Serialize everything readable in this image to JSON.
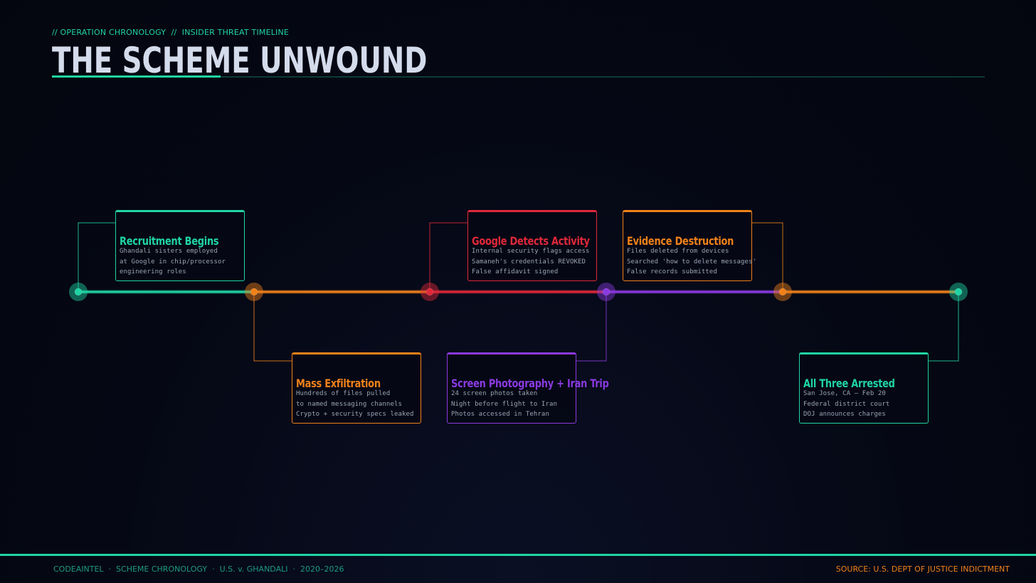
{
  "header": {
    "eyebrow": "// OPERATION CHRONOLOGY  //  INSIDER THREAT TIMELINE",
    "title": "THE SCHEME UNWOUND"
  },
  "colors": {
    "teal": "#20d4a4",
    "orange": "#f0811a",
    "red": "#e0283a",
    "purple": "#8a3ae0",
    "text_muted": "#9aa3b4",
    "background": "#050814"
  },
  "timeline": {
    "nodes": [
      {
        "color": "#20d4a4"
      },
      {
        "color": "#f0811a"
      },
      {
        "color": "#e0283a"
      },
      {
        "color": "#8a3ae0"
      },
      {
        "color": "#f0811a"
      },
      {
        "color": "#20d4a4"
      }
    ],
    "events": [
      {
        "title": "Recruitment Begins",
        "color": "#20d4a4",
        "placement": "above",
        "lines": [
          "Ghandali sisters employed",
          "at Google in chip/processor",
          "engineering roles"
        ]
      },
      {
        "title": "Mass Exfiltration",
        "color": "#f0811a",
        "placement": "below",
        "lines": [
          "Hundreds of files pulled",
          "to named messaging channels",
          "Crypto + security specs leaked"
        ]
      },
      {
        "title": "Google Detects Activity",
        "color": "#e0283a",
        "placement": "above",
        "lines": [
          "Internal security flags access",
          "Samaneh's credentials REVOKED",
          "False affidavit signed"
        ]
      },
      {
        "title": "Screen Photography + Iran Trip",
        "color": "#8a3ae0",
        "placement": "below",
        "lines": [
          "24 screen photos taken",
          "Night before flight to Iran",
          "Photos accessed in Tehran"
        ]
      },
      {
        "title": "Evidence Destruction",
        "color": "#f0811a",
        "placement": "above",
        "lines": [
          "Files deleted from devices",
          "Searched 'how to delete messages'",
          "False records submitted"
        ]
      },
      {
        "title": "All Three Arrested",
        "color": "#20d4a4",
        "placement": "below",
        "lines": [
          "San Jose, CA — Feb 20",
          "Federal district court",
          "DOJ announces charges"
        ]
      }
    ]
  },
  "footer": {
    "left": "CODEAINTEL  ·  SCHEME CHRONOLOGY  ·  U.S. v. GHANDALI  ·  2020–2026",
    "right": "SOURCE: U.S. DEPT OF JUSTICE INDICTMENT"
  }
}
